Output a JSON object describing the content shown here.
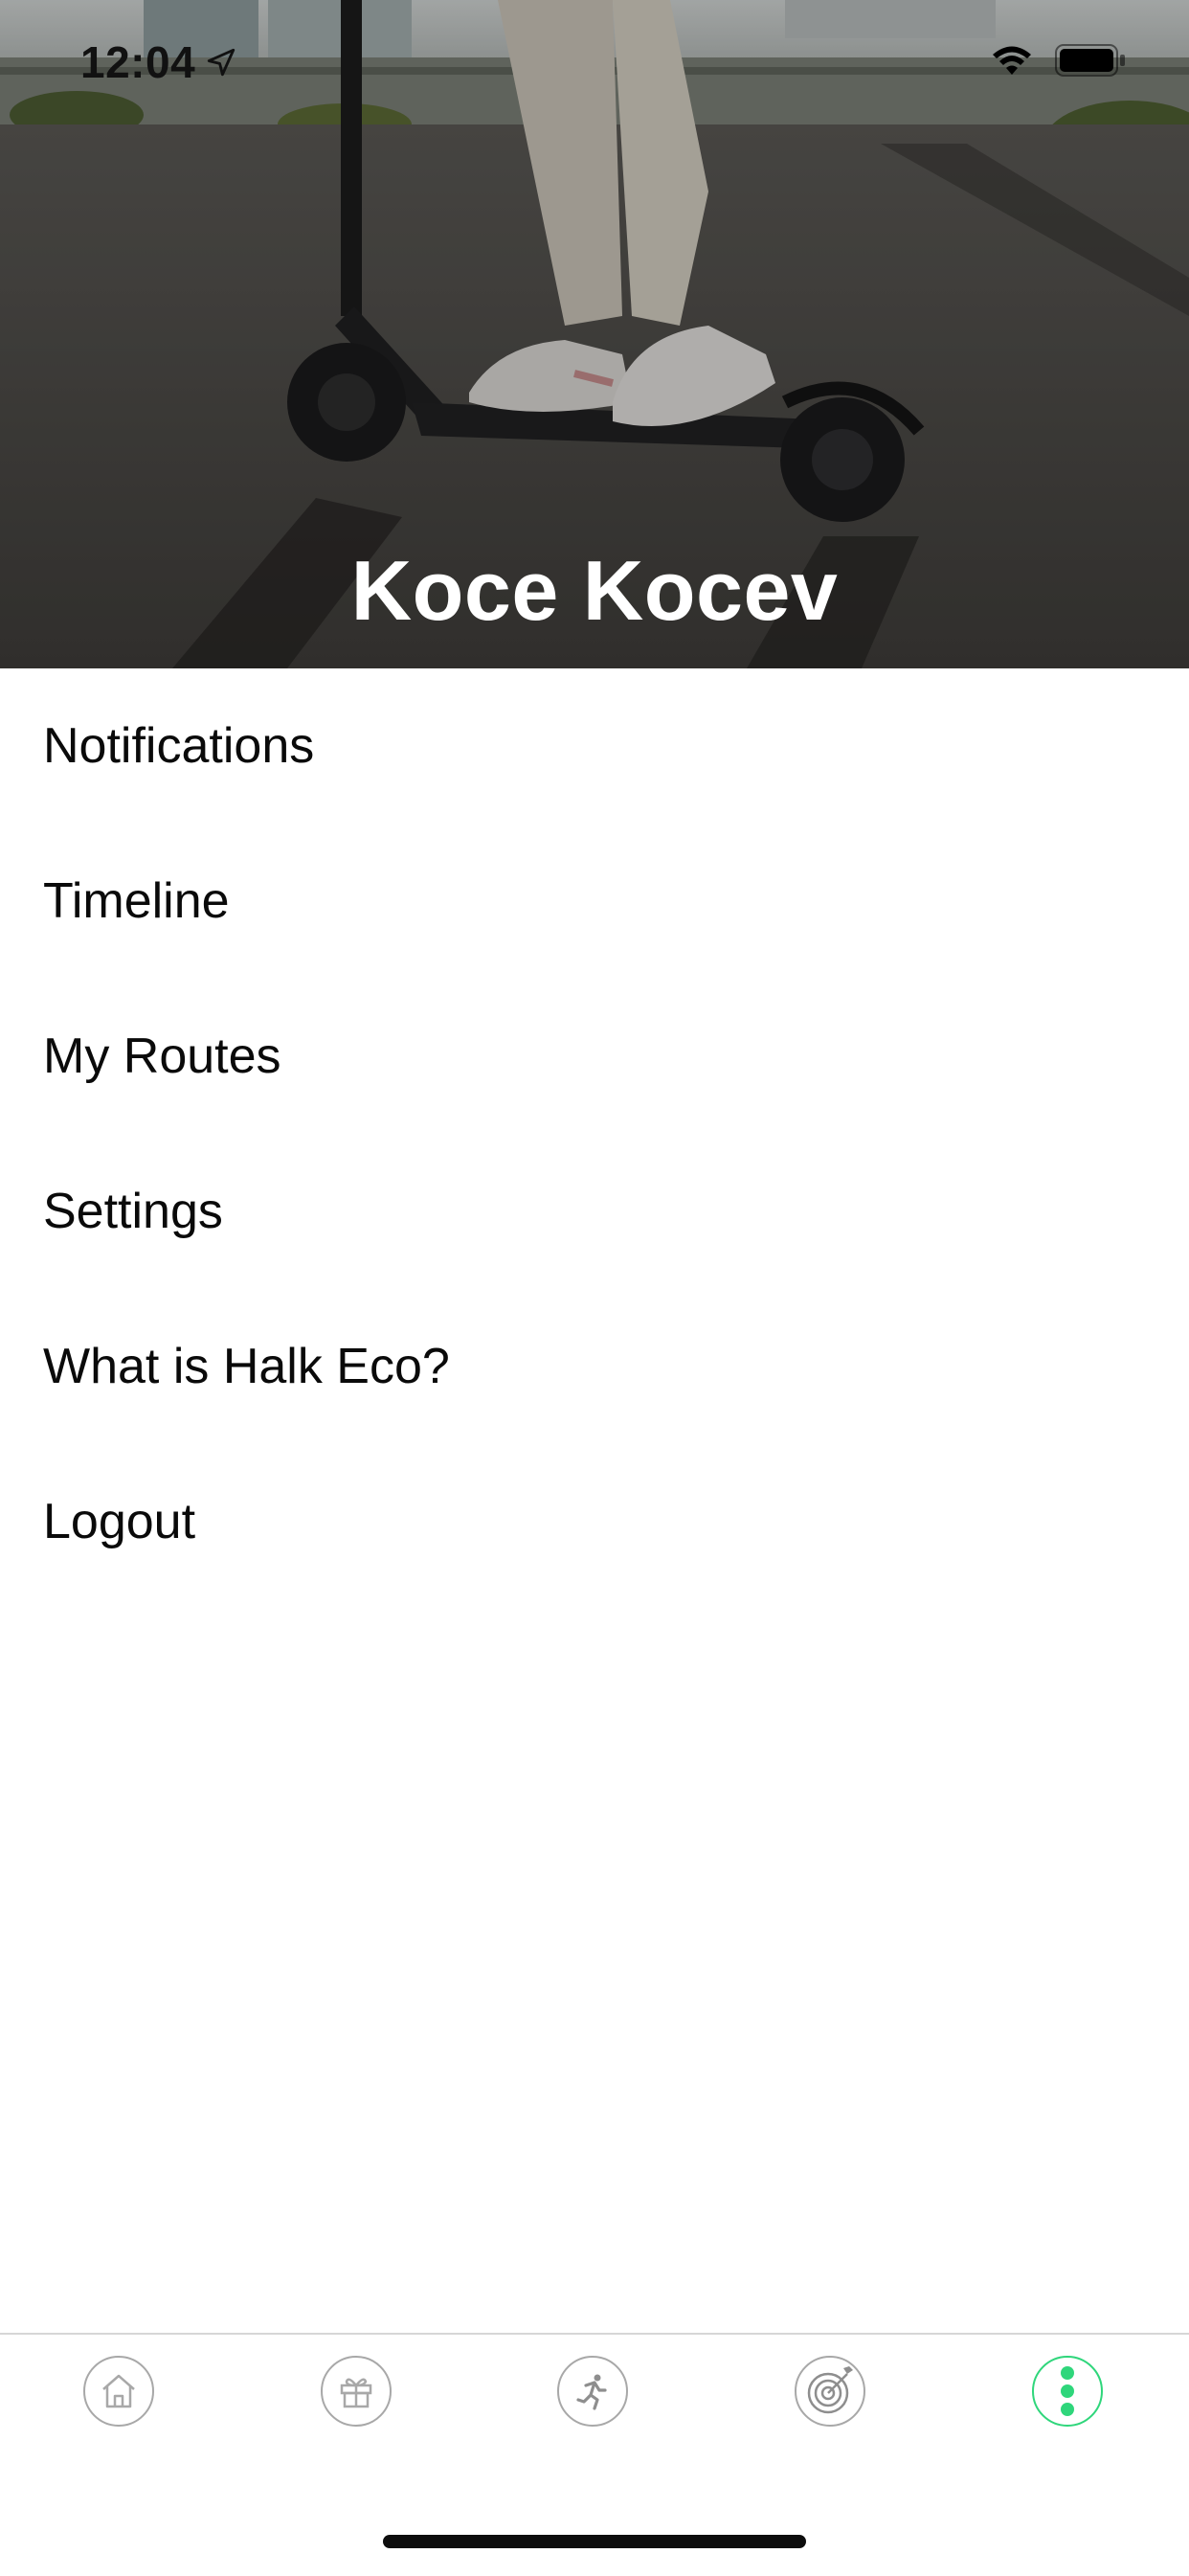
{
  "status_bar": {
    "time": "12:04"
  },
  "profile": {
    "name": "Koce Kocev"
  },
  "menu": {
    "items": [
      {
        "label": "Notifications"
      },
      {
        "label": "Timeline"
      },
      {
        "label": "My Routes"
      },
      {
        "label": "Settings"
      },
      {
        "label": "What is Halk Eco?"
      },
      {
        "label": "Logout"
      }
    ]
  },
  "tabs": [
    {
      "icon": "home-icon",
      "active": false
    },
    {
      "icon": "gift-icon",
      "active": false
    },
    {
      "icon": "runner-icon",
      "active": false
    },
    {
      "icon": "target-icon",
      "active": false
    },
    {
      "icon": "more-dots-icon",
      "active": true
    }
  ],
  "colors": {
    "accent": "#2fd67b",
    "tab_inactive": "#a8a8a8",
    "text": "#0a0a0a"
  }
}
